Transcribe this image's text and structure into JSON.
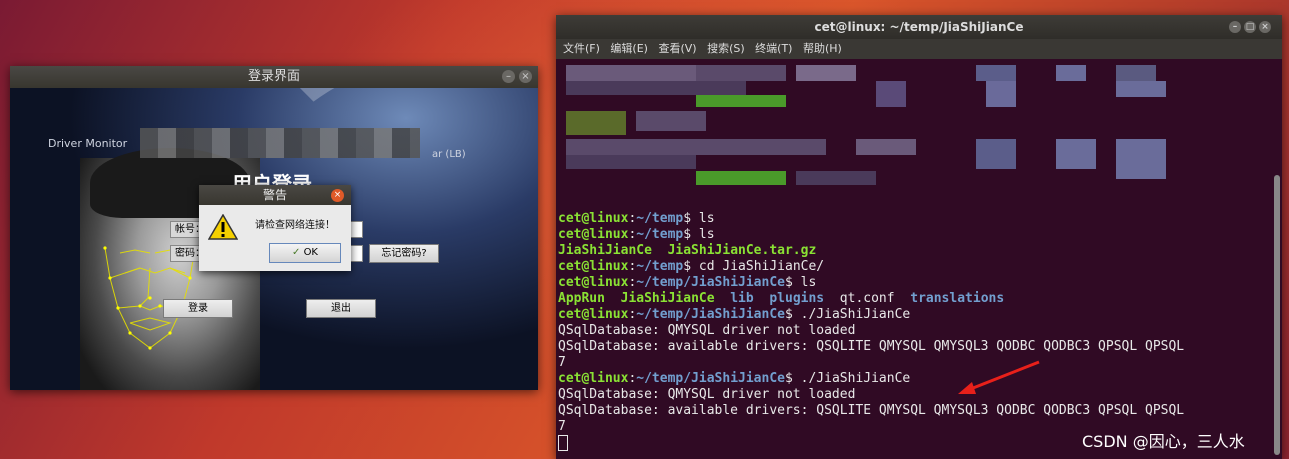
{
  "login_window": {
    "title": "登录界面",
    "header_text": "Driver Monitor",
    "header_suffix": "ar (LB)",
    "heading": "用户登录",
    "account_label": "帐号：",
    "password_label": "密码：",
    "forgot_button": "忘记密码?",
    "login_button": "登录",
    "exit_button": "退出"
  },
  "alert": {
    "title": "警告",
    "message": "请检查网络连接！",
    "ok_button": "OK"
  },
  "terminal": {
    "title": "cet@linux: ~/temp/JiaShiJianCe",
    "menu": [
      "文件(F)",
      "编辑(E)",
      "查看(V)",
      "搜索(S)",
      "终端(T)",
      "帮助(H)"
    ],
    "lines": [
      {
        "prompt": "cet@linux",
        "path": "~/temp",
        "cmd": "$ ls"
      },
      {
        "prompt": "cet@linux",
        "path": "~/temp",
        "cmd": "$ ls"
      },
      {
        "listing": [
          "JiaShiJianCe",
          "JiaShiJianCe.tar.gz"
        ]
      },
      {
        "prompt": "cet@linux",
        "path": "~/temp",
        "cmd": "$ cd JiaShiJianCe/"
      },
      {
        "prompt": "cet@linux",
        "path": "~/temp/JiaShiJianCe",
        "cmd": "$ ls"
      },
      {
        "listing2": [
          "AppRun",
          "JiaShiJianCe",
          "lib",
          "plugins",
          "qt.conf",
          "translations"
        ]
      },
      {
        "prompt": "cet@linux",
        "path": "~/temp/JiaShiJianCe",
        "cmd": "$ ./JiaShiJianCe"
      },
      {
        "text": "QSqlDatabase: QMYSQL driver not loaded"
      },
      {
        "text": "QSqlDatabase: available drivers: QSQLITE QMYSQL QMYSQL3 QODBC QODBC3 QPSQL QPSQL"
      },
      {
        "text": "7"
      },
      {
        "prompt": "cet@linux",
        "path": "~/temp/JiaShiJianCe",
        "cmd": "$ ./JiaShiJianCe"
      },
      {
        "text": "QSqlDatabase: QMYSQL driver not loaded"
      },
      {
        "text": "QSqlDatabase: available drivers: QSQLITE QMYSQL QMYSQL3 QODBC QODBC3 QPSQL QPSQL"
      },
      {
        "text": "7"
      }
    ]
  },
  "watermark": "CSDN @因心，三人水",
  "colors": {
    "prompt": "#8ae234",
    "path": "#729fcf",
    "terminal_bg": "#300a24",
    "arrow": "#e8201a"
  }
}
